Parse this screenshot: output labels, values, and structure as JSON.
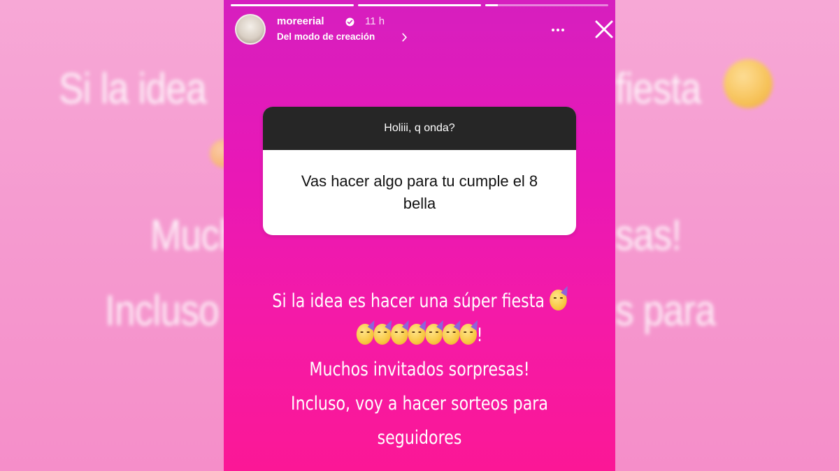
{
  "background_echo": {
    "line1": "Si la idea",
    "line1_right": "fiesta",
    "line2": "Much",
    "line2_right": "sas!",
    "line3": "Incluso",
    "line3_right": "s para"
  },
  "story": {
    "progress": [
      1,
      1,
      0.1
    ],
    "header": {
      "username": "moreerial",
      "time": "11 h",
      "subtitle": "Del modo de creación",
      "verified_icon": "verified-badge-icon",
      "more_icon": "more-horizontal-icon",
      "close_icon": "close-icon"
    },
    "question_sticker": {
      "prompt": "Holiii, q onda?",
      "question": "Vas hacer algo para tu cumple el 8 bella"
    },
    "text": {
      "line1": "Si la idea es hacer una súper fiesta",
      "line2_suffix": "!",
      "line3": "Muchos invitados sorpresas!",
      "line4": "Incluso, voy a hacer sorteos para",
      "line5": "seguidores"
    },
    "emoji_name": "partying-face-emoji"
  },
  "colors": {
    "story_top": "#d61fbf",
    "story_bottom": "#fb1796",
    "sticker_header": "#262626",
    "page_bg": "#f59bd0"
  }
}
